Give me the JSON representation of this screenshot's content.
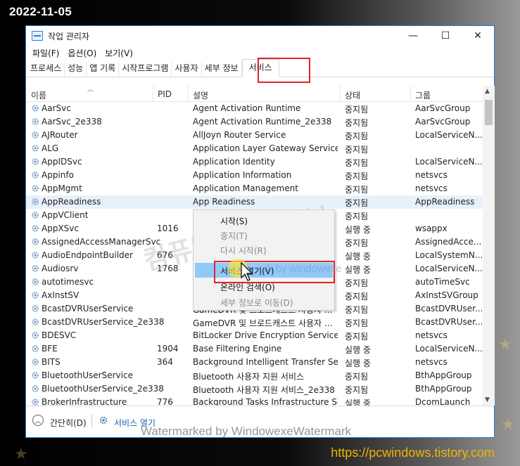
{
  "overlay": {
    "date": "2022-11-05",
    "url": "https://pcwindows.tistory.com",
    "watermark_bottom": "Watermarked by WindowexeWatermark",
    "watermark_center": "컴퓨터 관련 정보",
    "watermark_mid": "rk by windowexe"
  },
  "window": {
    "title": "작업 관리자",
    "minimize": "—",
    "maximize": "☐",
    "close": "✕"
  },
  "menu": [
    "파일(F)",
    "옵션(O)",
    "보기(V)"
  ],
  "tabs": [
    "프로세스",
    "성능",
    "앱 기록",
    "시작프로그램",
    "사용자",
    "세부 정보",
    "서비스"
  ],
  "active_tab": "서비스",
  "columns": {
    "name": "이름",
    "pid": "PID",
    "desc": "설명",
    "status": "상태",
    "group": "그룹"
  },
  "rows": [
    {
      "name": "AarSvc",
      "pid": "",
      "desc": "Agent Activation Runtime",
      "status": "중지됨",
      "group": "AarSvcGroup"
    },
    {
      "name": "AarSvc_2e338",
      "pid": "",
      "desc": "Agent Activation Runtime_2e338",
      "status": "중지됨",
      "group": "AarSvcGroup"
    },
    {
      "name": "AJRouter",
      "pid": "",
      "desc": "AllJoyn Router Service",
      "status": "중지됨",
      "group": "LocalServiceN..."
    },
    {
      "name": "ALG",
      "pid": "",
      "desc": "Application Layer Gateway Service",
      "status": "중지됨",
      "group": ""
    },
    {
      "name": "AppIDSvc",
      "pid": "",
      "desc": "Application Identity",
      "status": "중지됨",
      "group": "LocalServiceN..."
    },
    {
      "name": "Appinfo",
      "pid": "",
      "desc": "Application Information",
      "status": "중지됨",
      "group": "netsvcs"
    },
    {
      "name": "AppMgmt",
      "pid": "",
      "desc": "Application Management",
      "status": "중지됨",
      "group": "netsvcs"
    },
    {
      "name": "AppReadiness",
      "pid": "",
      "desc": "App Readiness",
      "status": "중지됨",
      "group": "AppReadiness"
    },
    {
      "name": "AppVClient",
      "pid": "",
      "desc": "",
      "status": "중지됨",
      "group": ""
    },
    {
      "name": "AppXSvc",
      "pid": "1016",
      "desc": "",
      "status": "실행 중",
      "group": "wsappx"
    },
    {
      "name": "AssignedAccessManagerSvc",
      "pid": "",
      "desc": "",
      "status": "중지됨",
      "group": "AssignedAcce..."
    },
    {
      "name": "AudioEndpointBuilder",
      "pid": "676",
      "desc": "",
      "status": "실행 중",
      "group": "LocalSystemN..."
    },
    {
      "name": "Audiosrv",
      "pid": "1768",
      "desc": "",
      "status": "실행 중",
      "group": "LocalServiceN..."
    },
    {
      "name": "autotimesvc",
      "pid": "",
      "desc": "",
      "status": "중지됨",
      "group": "autoTimeSvc"
    },
    {
      "name": "AxInstSV",
      "pid": "",
      "desc": "",
      "status": "중지됨",
      "group": "AxInstSVGroup"
    },
    {
      "name": "BcastDVRUserService",
      "pid": "",
      "desc": "GameDVR 및 브로드캐스트 사용자 ...",
      "status": "중지됨",
      "group": "BcastDVRUser..."
    },
    {
      "name": "BcastDVRUserService_2e338",
      "pid": "",
      "desc": "GameDVR 및 브로드캐스트 사용자 ...",
      "status": "중지됨",
      "group": "BcastDVRUser..."
    },
    {
      "name": "BDESVC",
      "pid": "",
      "desc": "BitLocker Drive Encryption Service",
      "status": "중지됨",
      "group": "netsvcs"
    },
    {
      "name": "BFE",
      "pid": "1904",
      "desc": "Base Filtering Engine",
      "status": "실행 중",
      "group": "LocalServiceN..."
    },
    {
      "name": "BITS",
      "pid": "364",
      "desc": "Background Intelligent Transfer Ser...",
      "status": "실행 중",
      "group": "netsvcs"
    },
    {
      "name": "BluetoothUserService",
      "pid": "",
      "desc": "Bluetooth 사용자 지원 서비스",
      "status": "중지됨",
      "group": "BthAppGroup"
    },
    {
      "name": "BluetoothUserService_2e338",
      "pid": "",
      "desc": "Bluetooth 사용자 지원 서비스_2e338",
      "status": "중지됨",
      "group": "BthAppGroup"
    },
    {
      "name": "BrokerInfrastructure",
      "pid": "776",
      "desc": "Background Tasks Infrastructure Ser...",
      "status": "실행 중",
      "group": "DcomLaunch"
    }
  ],
  "selected_row": 7,
  "context_menu": {
    "items": [
      {
        "label": "시작(S)",
        "state": "enabled"
      },
      {
        "label": "중지(T)",
        "state": "disabled"
      },
      {
        "label": "다시 시작(R)",
        "state": "disabled"
      },
      {
        "label": "서비스 열기(V)",
        "state": "highlighted"
      },
      {
        "label": "온라인 검색(O)",
        "state": "enabled"
      },
      {
        "label": "세부 정보로 이동(D)",
        "state": "disabled"
      }
    ]
  },
  "footer": {
    "collapse_label": "간단히(D)",
    "open_services_label": "서비스 열기"
  },
  "colors": {
    "accent": "#1b7fd6",
    "highlight_box": "#e0232e",
    "menu_highlight": "#91c9f7",
    "url": "#f2b400"
  }
}
